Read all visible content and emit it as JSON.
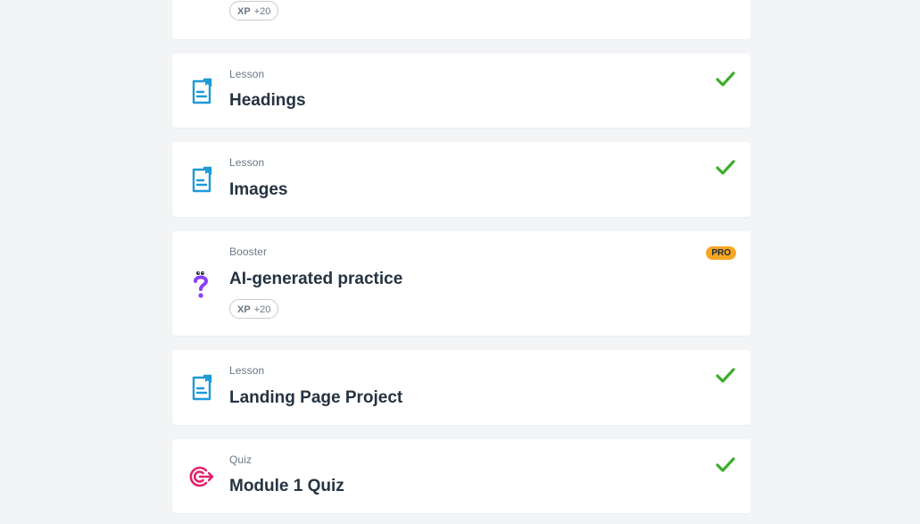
{
  "colors": {
    "background": "#f2f4f6",
    "card": "#ffffff",
    "check": "#3dae2b",
    "lesson_icon": "#1d9ad6",
    "booster_icon": "#8a3ffc",
    "quiz_icon": "#e0226a",
    "pro_badge": "#f5a623"
  },
  "items": [
    {
      "kind": "",
      "title": "",
      "xp_label": "XP",
      "xp_value": "+20",
      "icon": "none",
      "completed": false
    },
    {
      "kind": "Lesson",
      "title": "Headings",
      "icon": "lesson-icon",
      "completed": true
    },
    {
      "kind": "Lesson",
      "title": "Images",
      "icon": "lesson-icon",
      "completed": true
    },
    {
      "kind": "Booster",
      "title": "AI-generated practice",
      "badge": "PRO",
      "xp_label": "XP",
      "xp_value": "+20",
      "icon": "question-mark-icon",
      "completed": false
    },
    {
      "kind": "Lesson",
      "title": "Landing Page Project",
      "icon": "lesson-icon",
      "completed": true
    },
    {
      "kind": "Quiz",
      "title": "Module 1 Quiz",
      "icon": "target-icon",
      "completed": true
    }
  ]
}
